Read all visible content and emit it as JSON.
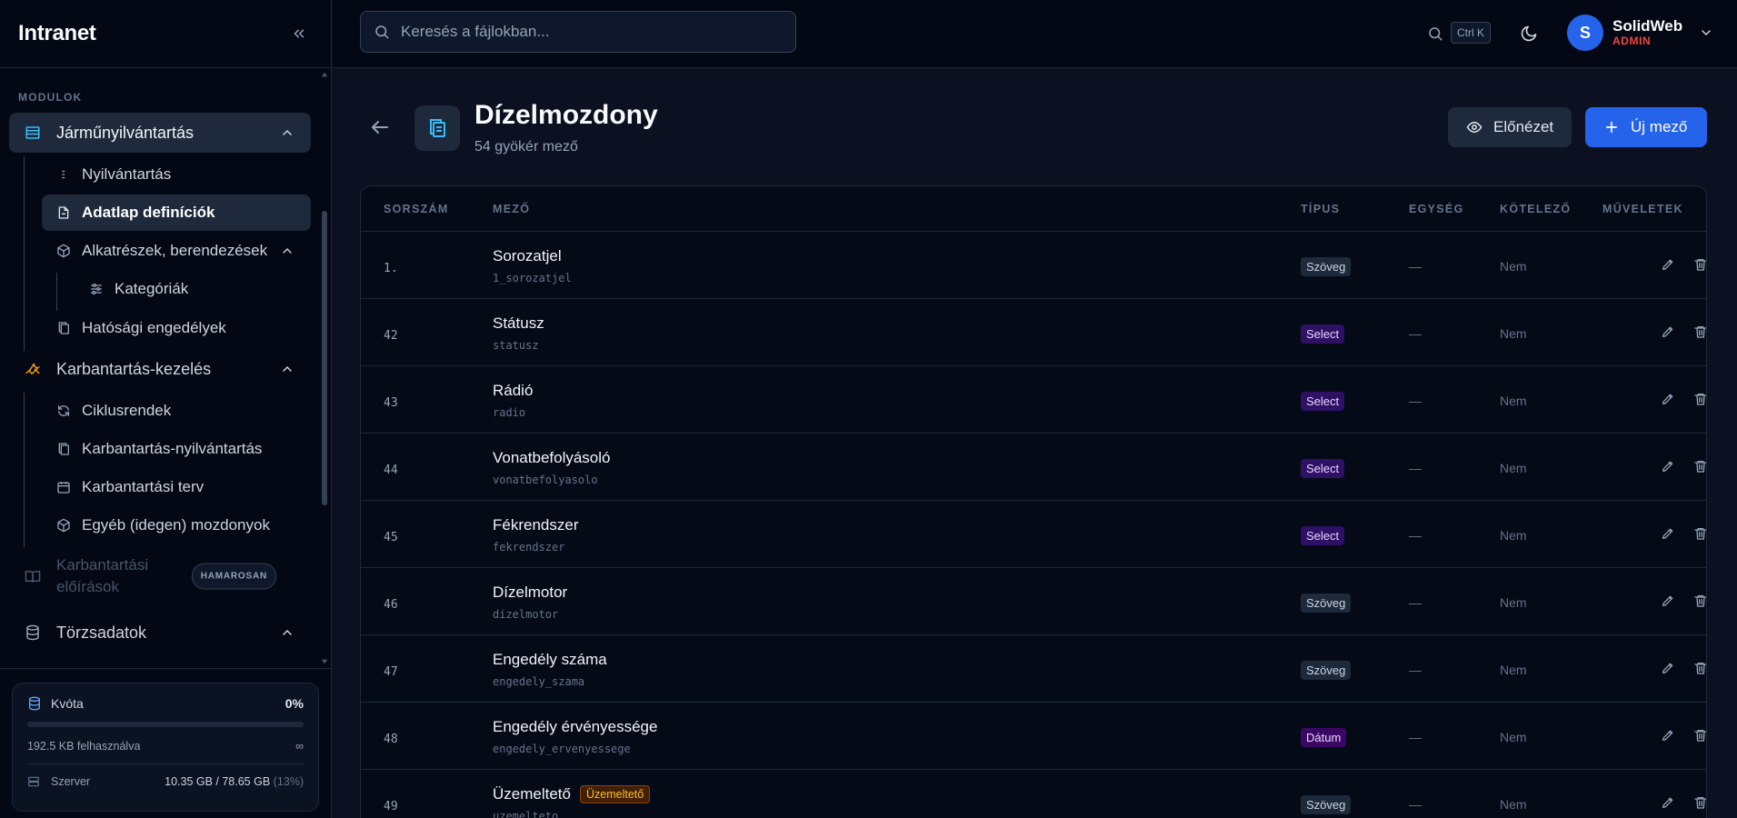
{
  "app": {
    "brand": "Intranet"
  },
  "sidebar": {
    "section_label": "MODULOK",
    "items": [
      {
        "label": "Járműnyilvántartás",
        "icon": "database-table-icon"
      },
      {
        "label": "Nyilvántartás",
        "icon": "list-icon"
      },
      {
        "label": "Adatlap definíciók",
        "icon": "file-icon"
      },
      {
        "label": "Alkatrészek, berendezések",
        "icon": "box-icon"
      },
      {
        "label": "Kategóriák",
        "icon": "sliders-icon"
      },
      {
        "label": "Hatósági engedélyek",
        "icon": "copy-icon"
      },
      {
        "label": "Karbantartás-kezelés",
        "icon": "wrench-icon"
      },
      {
        "label": "Ciklusrendek",
        "icon": "refresh-icon"
      },
      {
        "label": "Karbantartás-nyilvántartás",
        "icon": "copy-icon"
      },
      {
        "label": "Karbantartási terv",
        "icon": "calendar-icon"
      },
      {
        "label": "Egyéb (idegen) mozdonyok",
        "icon": "box-icon"
      },
      {
        "label": "Karbantartási előírások",
        "icon": "book-icon",
        "badge": "HAMAROSAN"
      },
      {
        "label": "Törzsadatok",
        "icon": "database-icon"
      }
    ],
    "quota": {
      "title": "Kvóta",
      "percent": "0%",
      "progress_fraction": 0,
      "used": "192.5 KB felhasználva",
      "limit": "∞",
      "server_label": "Szerver",
      "server_value": "10.35 GB / 78.65 GB",
      "server_pct": "(13%)"
    }
  },
  "topbar": {
    "search_placeholder": "Keresés a fájlokban...",
    "shortcut": "Ctrl K",
    "user": {
      "initial": "S",
      "name": "SolidWeb",
      "role": "ADMIN"
    }
  },
  "page": {
    "title": "Dízelmozdony",
    "subtitle": "54 gyökér mező",
    "preview_label": "Előnézet",
    "new_label": "Új mező"
  },
  "table": {
    "columns": [
      "SORSZÁM",
      "MEZŐ",
      "TÍPUS",
      "EGYSÉG",
      "KÖTELEZŐ",
      "MŰVELETEK"
    ],
    "rows": [
      {
        "num": "1.",
        "name": "Sorozatjel",
        "key": "1_sorozatjel",
        "type": "Szöveg",
        "unit": "—",
        "required": "Nem"
      },
      {
        "num": "42",
        "name": "Státusz",
        "key": "statusz",
        "type": "Select",
        "unit": "—",
        "required": "Nem"
      },
      {
        "num": "43",
        "name": "Rádió",
        "key": "radio",
        "type": "Select",
        "unit": "—",
        "required": "Nem"
      },
      {
        "num": "44",
        "name": "Vonatbefolyásoló",
        "key": "vonatbefolyasolo",
        "type": "Select",
        "unit": "—",
        "required": "Nem"
      },
      {
        "num": "45",
        "name": "Fékrendszer",
        "key": "fekrendszer",
        "type": "Select",
        "unit": "—",
        "required": "Nem"
      },
      {
        "num": "46",
        "name": "Dízelmotor",
        "key": "dizelmotor",
        "type": "Szöveg",
        "unit": "—",
        "required": "Nem"
      },
      {
        "num": "47",
        "name": "Engedély száma",
        "key": "engedely_szama",
        "type": "Szöveg",
        "unit": "—",
        "required": "Nem"
      },
      {
        "num": "48",
        "name": "Engedély érvényessége",
        "key": "engedely_ervenyessege",
        "type": "Dátum",
        "unit": "—",
        "required": "Nem"
      },
      {
        "num": "49",
        "name": "Üzemeltető",
        "key": "uzemelteto",
        "tag": "Üzemeltető",
        "type": "Szöveg",
        "unit": "—",
        "required": "Nem"
      }
    ]
  },
  "colors": {
    "accent": "#2563eb",
    "admin": "#ef4444",
    "select_badge": "#2e1065",
    "orange_tag": "#fbbf24"
  }
}
